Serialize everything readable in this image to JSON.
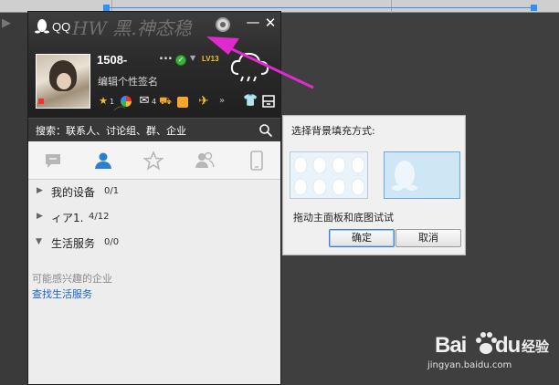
{
  "qq_panel": {
    "title": "QQ",
    "nickname": "1508-",
    "nickname_more": "...",
    "level": "LV13",
    "signature": "编辑个性签名",
    "scribble": "HW 黑.神态稳",
    "counters": {
      "mail": "4",
      "first": "1"
    },
    "search_label": "搜索：联系人、讨论组、群、企业",
    "groups": [
      {
        "name": "我的设备",
        "count": "0/1",
        "expanded": false
      },
      {
        "name": "ィア1.",
        "count": "4/12",
        "expanded": false
      },
      {
        "name": "生活服务",
        "count": "0/0",
        "expanded": true
      }
    ],
    "maybe_interested": "可能感兴趣的企业",
    "find_service": "查找生活服务"
  },
  "dialog": {
    "title": "选择背景填充方式:",
    "hint": "拖动主面板和底图试试",
    "ok_label": "确定",
    "cancel_label": "取消"
  },
  "watermark": {
    "brand": "Bai",
    "brand_tail": "du",
    "cn": "经验",
    "url": "jingyan.baidu.com"
  },
  "colors": {
    "accent_pink": "#e02ad0",
    "selection_blue": "#2f8fff",
    "link_blue": "#1a63c7"
  },
  "icons": [
    "qq-penguin-icon",
    "skin-icon",
    "minimize-icon",
    "close-icon",
    "online-status-icon",
    "weather-cloud-icon",
    "search-icon",
    "chat-tab-icon",
    "contacts-tab-icon",
    "favorites-tab-icon",
    "groups-tab-icon",
    "phone-tab-icon",
    "shirt-icon",
    "app-box-icon"
  ]
}
